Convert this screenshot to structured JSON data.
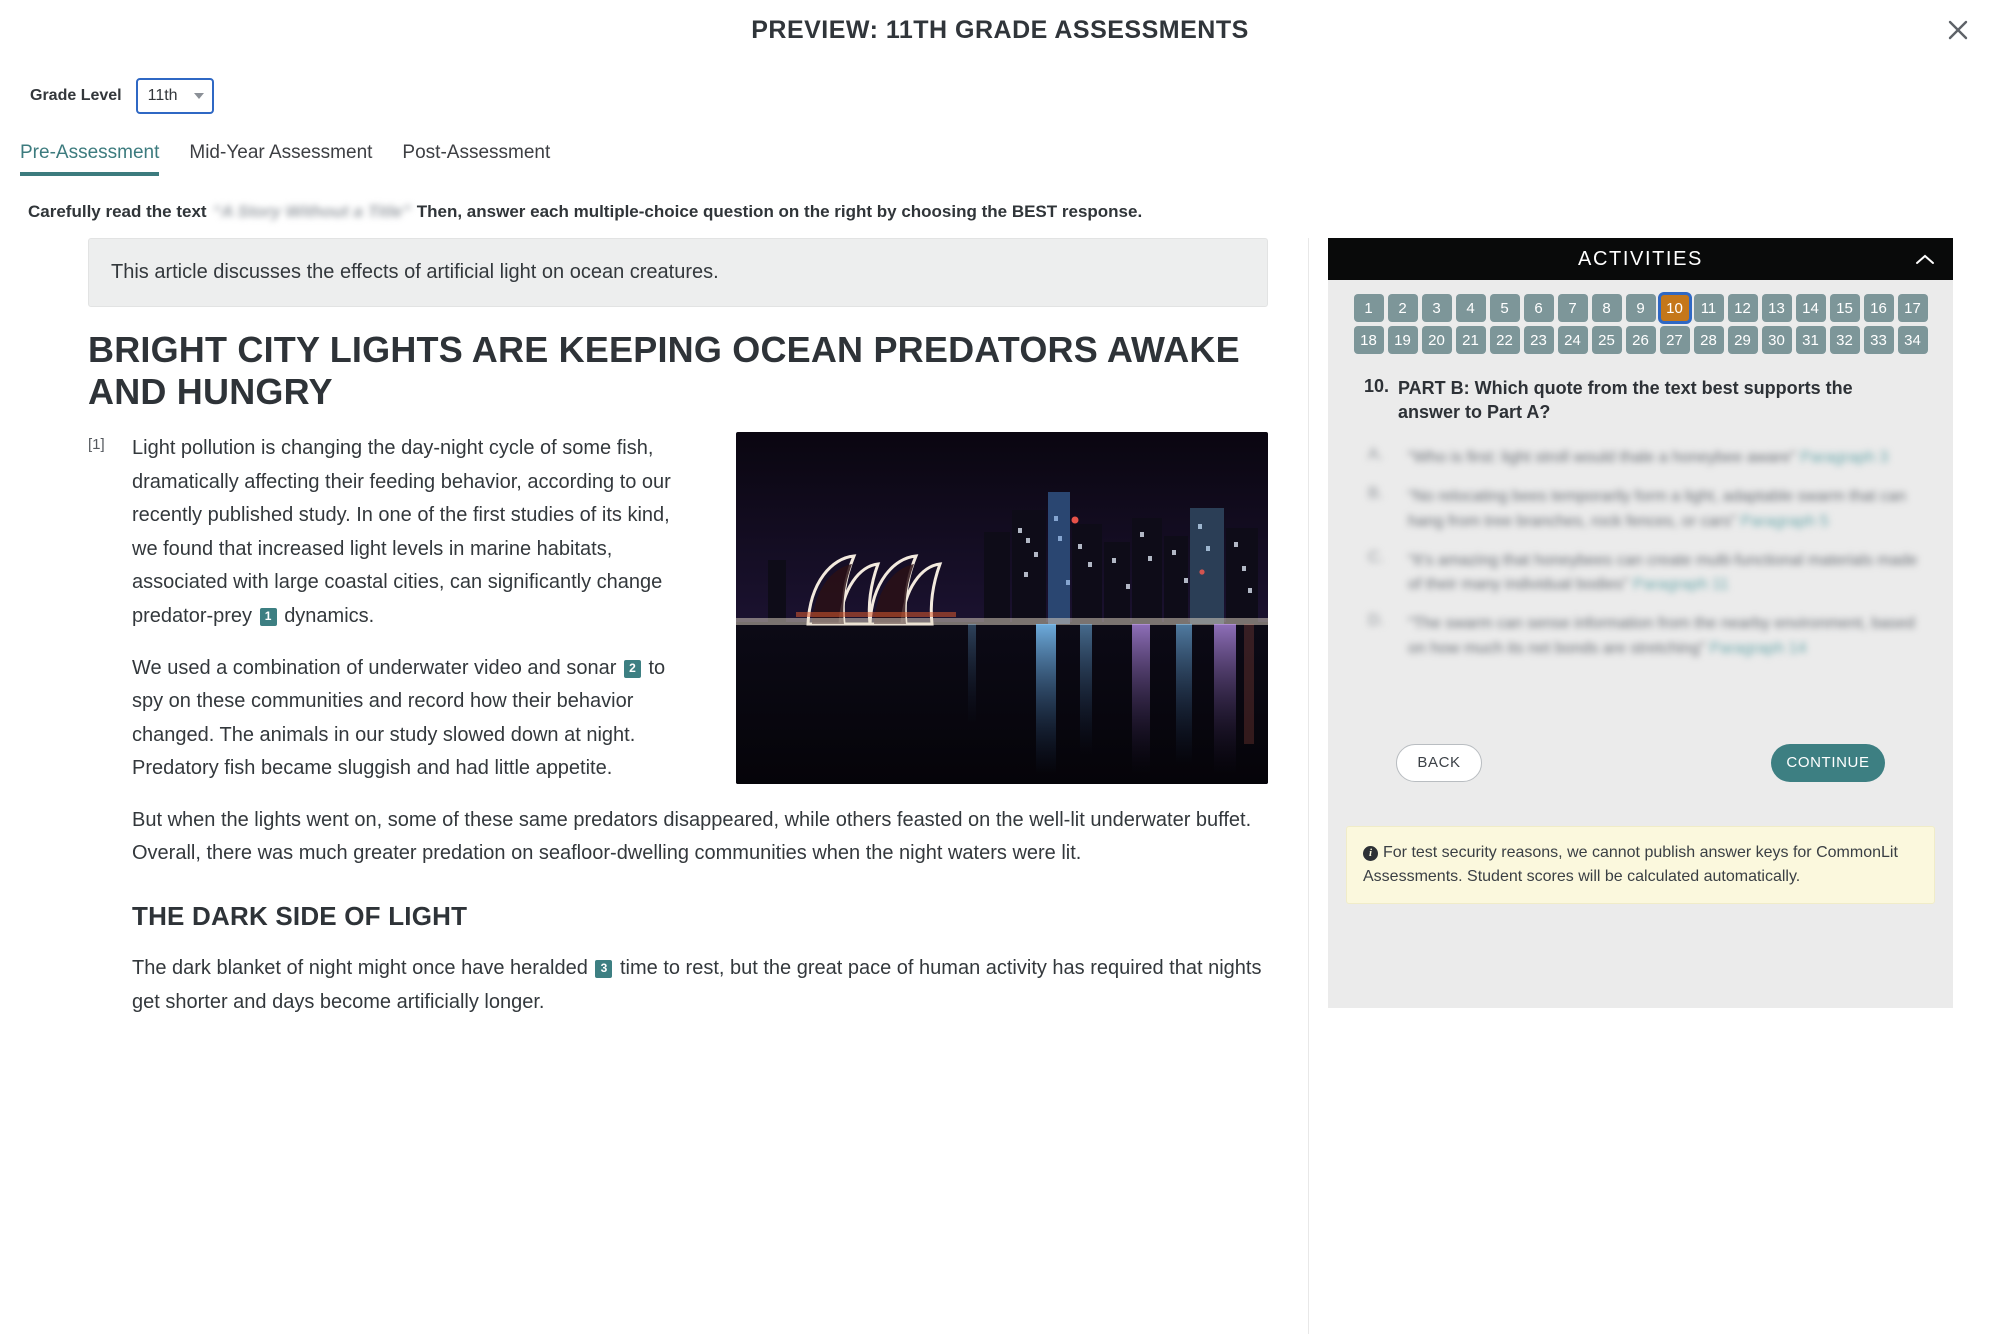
{
  "header": {
    "title": "PREVIEW: 11TH GRADE ASSESSMENTS",
    "close_icon": "close-icon"
  },
  "grade": {
    "label": "Grade Level",
    "value": "11th",
    "options": [
      "11th"
    ],
    "caret_icon": "chevron-down-icon"
  },
  "tabs": [
    {
      "label": "Pre-Assessment",
      "active": true
    },
    {
      "label": "Mid-Year Assessment",
      "active": false
    },
    {
      "label": "Post-Assessment",
      "active": false
    }
  ],
  "instruction": {
    "before": "Carefully read the text",
    "redacted_title": "“A Story Without a Title”",
    "after": "Then, answer each multiple-choice question on the right by choosing the BEST response."
  },
  "article": {
    "summary": "This article discusses the effects of artificial light on ocean creatures.",
    "title": "BRIGHT CITY LIGHTS ARE KEEPING OCEAN PREDATORS AWAKE AND HUNGRY",
    "paragraph_number": "[1]",
    "p1_a": "Light pollution is changing the day-night cycle of some fish, dramatically affecting their feeding behavior, according to our recently published study. In one of the first studies of its kind, we found that increased light levels in marine habitats, associated with large coastal cities, can significantly change predator-prey",
    "p1_ann": "1",
    "p1_b": "dynamics.",
    "p2_a": "We used a combination of underwater video and sonar",
    "p2_ann": "2",
    "p2_b": "to spy on these communities and record how their behavior changed. The animals in our study slowed down at night. Predatory fish became sluggish and had little appetite.",
    "p3": "But when the lights went on, some of these same predators disappeared, while others feasted on the well-lit underwater buffet. Overall, there was much greater predation on seafloor-dwelling communities when the night waters were lit.",
    "section_heading": "THE DARK SIDE OF LIGHT",
    "p4_a": "The dark blanket of night might once have heralded",
    "p4_ann": "3",
    "p4_b": "time to rest, but the great pace of human activity has required that nights get shorter and days become artificially longer.",
    "image_alt": "city-skyline-at-night-photo"
  },
  "activities": {
    "header": "ACTIVITIES",
    "collapse_icon": "chevron-up-icon",
    "numbers": [
      "1",
      "2",
      "3",
      "4",
      "5",
      "6",
      "7",
      "8",
      "9",
      "10",
      "11",
      "12",
      "13",
      "14",
      "15",
      "16",
      "17",
      "18",
      "19",
      "20",
      "21",
      "22",
      "23",
      "24",
      "25",
      "26",
      "27",
      "28",
      "29",
      "30",
      "31",
      "32",
      "33",
      "34"
    ],
    "current": "10",
    "question": {
      "number": "10.",
      "text": "PART B: Which quote from the text best supports the  answer to Part A?"
    },
    "choices": [
      {
        "letter": "A.",
        "text": "“Who is first: light stroll would thale a honeybee aware”",
        "paragraph": "Paragraph 3"
      },
      {
        "letter": "B.",
        "text": "“No relocating bees temporarily form a light, adaptable swarm that can hang from tree branches, rock fences, or cars”",
        "paragraph": "Paragraph 5"
      },
      {
        "letter": "C.",
        "text": "“It’s amazing that honeybees can create multi-functional materials made of their many individual bodies”",
        "paragraph": "Paragraph 11"
      },
      {
        "letter": "D.",
        "text": "“The swarm can sense information from the nearby environment, based on how much its net bonds are stretching”",
        "paragraph": "Paragraph 14"
      }
    ],
    "back_label": "BACK",
    "continue_label": "CONTINUE",
    "notice": "For test security reasons, we cannot publish answer keys for CommonLit Assessments. Student scores will be calculated automatically.",
    "info_icon": "info-icon"
  },
  "colors": {
    "teal": "#3d7f82",
    "tab_active": "#3c7b7e",
    "current_number": "#c5771a",
    "number_chip": "#7d9699",
    "focus_ring": "#2f68c4",
    "notice_bg": "#fbf8dd",
    "panel_bg": "#ebebeb",
    "header_bar": "#090a0a"
  }
}
